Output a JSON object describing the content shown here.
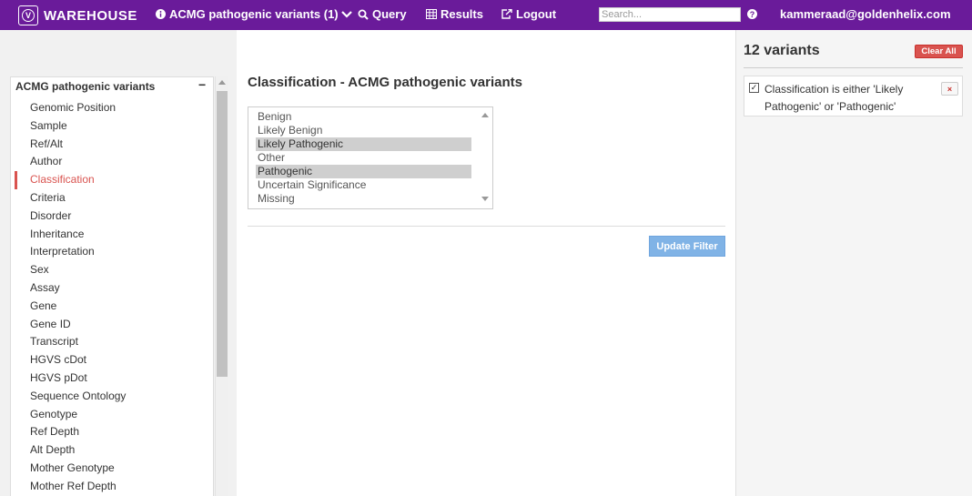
{
  "navbar": {
    "brand": "WAREHOUSE",
    "project_label": "ACMG pathogenic variants (1)",
    "query_label": "Query",
    "results_label": "Results",
    "logout_label": "Logout",
    "search_placeholder": "Search...",
    "help_label": "?",
    "user_email": "kammeraad@goldenhelix.com",
    "bg_color": "#6a1b9a"
  },
  "sidebar": {
    "title": "ACMG pathogenic variants",
    "collapse_symbol": "−",
    "fields": [
      "Genomic Position",
      "Sample",
      "Ref/Alt",
      "Author",
      "Classification",
      "Criteria",
      "Disorder",
      "Inheritance",
      "Interpretation",
      "Sex",
      "Assay",
      "Gene",
      "Gene ID",
      "Transcript",
      "HGVS cDot",
      "HGVS pDot",
      "Sequence Ontology",
      "Genotype",
      "Ref Depth",
      "Alt Depth",
      "Mother Genotype",
      "Mother Ref Depth"
    ],
    "active_field": "Classification",
    "active_color": "#d9534f"
  },
  "main": {
    "title": "Classification - ACMG pathogenic variants",
    "options": [
      "Benign",
      "Likely Benign",
      "Likely Pathogenic",
      "Other",
      "Pathogenic",
      "Uncertain Significance",
      "Missing"
    ],
    "selected_options": [
      "Likely Pathogenic",
      "Pathogenic"
    ],
    "update_button": "Update Filter"
  },
  "results": {
    "count_label": "12 variants",
    "clear_all": "Clear All",
    "filter_text": "Classification is either 'Likely Pathogenic' or 'Pathogenic'",
    "filter_checked": true,
    "remove_symbol": "×"
  }
}
